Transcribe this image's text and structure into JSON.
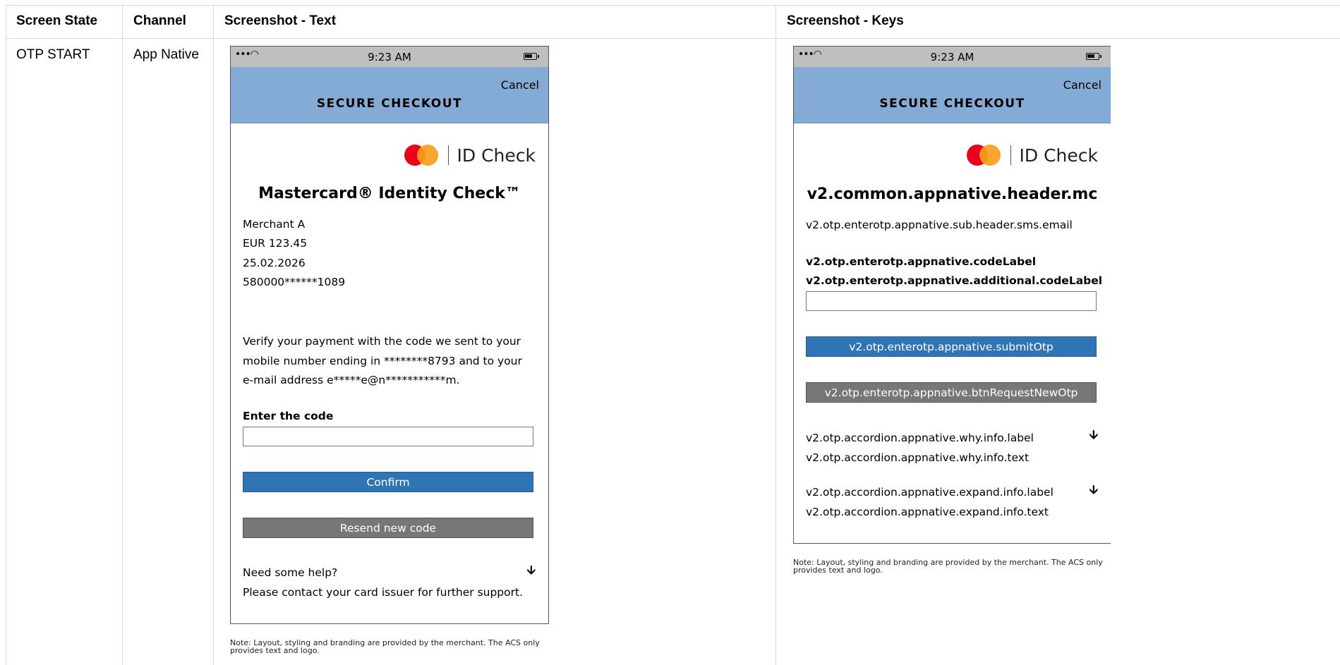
{
  "table": {
    "headers": [
      "Screen State",
      "Channel",
      "Screenshot - Text",
      "Screenshot - Keys"
    ],
    "row": {
      "screen_state": "OTP START",
      "channel": "App Native"
    }
  },
  "status_bar": {
    "signal": "•••◠",
    "time": "9:23 AM"
  },
  "text_phone": {
    "cancel": "Cancel",
    "header_title": "SECURE CHECKOUT",
    "logo_text": "ID Check",
    "title": "Mastercard® Identity Check™",
    "merchant": "Merchant A",
    "amount": "EUR 123.45",
    "date": "25.02.2026",
    "card": "580000******1089",
    "message_lines": [
      "Verify your payment with the code we sent to your",
      "mobile number ending in ********8793 and to your",
      "e-mail address e*****e@n***********m."
    ],
    "code_label": "Enter the code",
    "confirm": "Confirm",
    "resend": "Resend new code",
    "help_label": "Need some help?",
    "help_text": "Please contact your card issuer for further support.",
    "arrow": "🡫"
  },
  "keys_phone": {
    "cancel": "Cancel",
    "header_title": "SECURE CHECKOUT",
    "logo_text": "ID Check",
    "title": "v2.common.appnative.header.mc",
    "sub_header": "v2.otp.enterotp.appnative.sub.header.sms.email",
    "code_label": "v2.otp.enterotp.appnative.codeLabel",
    "additional_code_label": "v2.otp.enterotp.appnative.additional.codeLabel",
    "submit": "v2.otp.enterotp.appnative.submitOtp",
    "request_new": "v2.otp.enterotp.appnative.btnRequestNewOtp",
    "why_label": "v2.otp.accordion.appnative.why.info.label",
    "why_text": "v2.otp.accordion.appnative.why.info.text",
    "expand_label": "v2.otp.accordion.appnative.expand.info.label",
    "expand_text": "v2.otp.accordion.appnative.expand.info.text",
    "arrow": "🡫"
  },
  "note": "Note: Layout, styling and branding are provided by the merchant. The ACS only provides text and logo."
}
